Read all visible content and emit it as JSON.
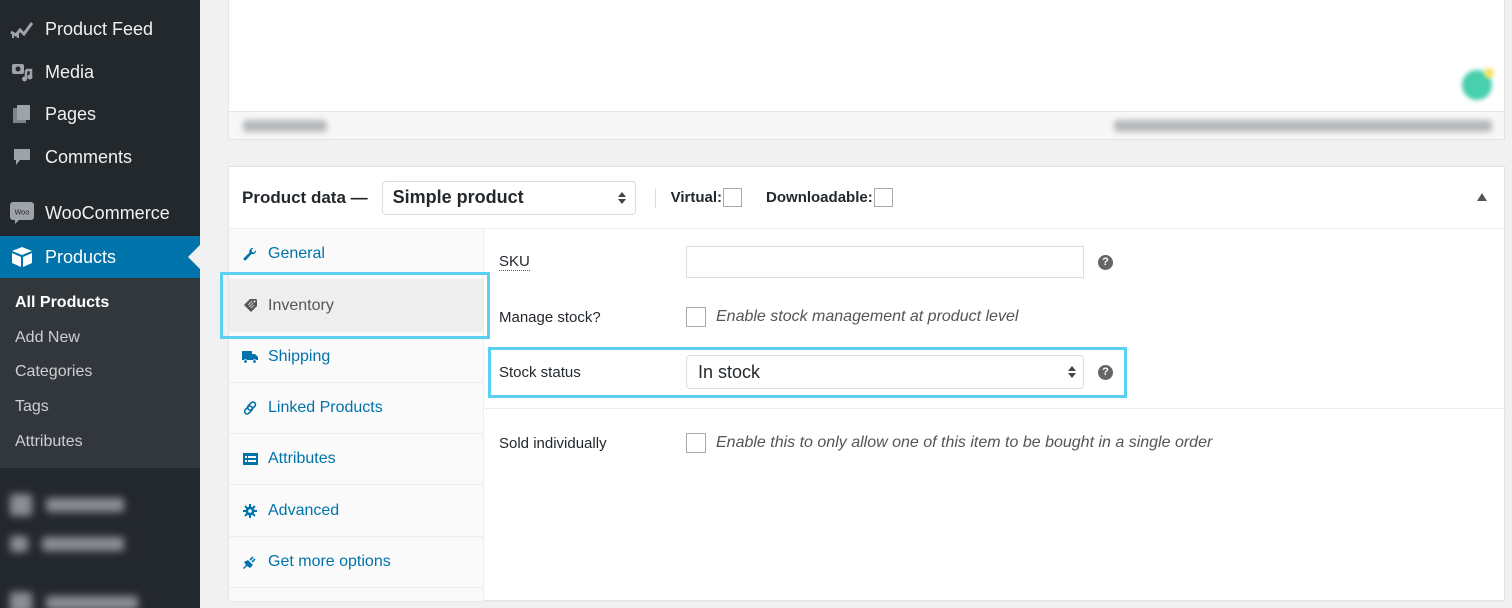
{
  "sidebar": {
    "items": [
      {
        "label": "Product Feed",
        "icon": "product-feed-icon"
      },
      {
        "label": "Media",
        "icon": "media-icon"
      },
      {
        "label": "Pages",
        "icon": "pages-icon"
      },
      {
        "label": "Comments",
        "icon": "comments-icon"
      },
      {
        "label": "WooCommerce",
        "icon": "woocommerce-icon"
      },
      {
        "label": "Products",
        "icon": "products-icon",
        "active": true
      }
    ],
    "submenu": [
      {
        "label": "All Products",
        "current": true
      },
      {
        "label": "Add New"
      },
      {
        "label": "Categories"
      },
      {
        "label": "Tags"
      },
      {
        "label": "Attributes"
      }
    ]
  },
  "product_data": {
    "title": "Product data —",
    "type_select": {
      "value": "Simple product"
    },
    "virtual_label": "Virtual:",
    "virtual_checked": false,
    "downloadable_label": "Downloadable:",
    "downloadable_checked": false,
    "tabs": [
      {
        "label": "General",
        "icon": "wrench-icon"
      },
      {
        "label": "Inventory",
        "icon": "tag-icon",
        "active": true
      },
      {
        "label": "Shipping",
        "icon": "truck-icon"
      },
      {
        "label": "Linked Products",
        "icon": "link-icon"
      },
      {
        "label": "Attributes",
        "icon": "list-icon"
      },
      {
        "label": "Advanced",
        "icon": "gear-icon"
      },
      {
        "label": "Get more options",
        "icon": "plug-icon"
      }
    ],
    "inventory": {
      "sku_label": "SKU",
      "sku_value": "",
      "manage_stock_label": "Manage stock?",
      "manage_stock_desc": "Enable stock management at product level",
      "manage_stock_checked": false,
      "stock_status_label": "Stock status",
      "stock_status_value": "In stock",
      "sold_individually_label": "Sold individually",
      "sold_individually_desc": "Enable this to only allow one of this item to be bought in a single order",
      "sold_individually_checked": false,
      "help_glyph": "?"
    }
  },
  "colors": {
    "sidebar_bg": "#23282d",
    "active_menu": "#0073aa",
    "highlight": "#5bd0f0",
    "link": "#0073aa"
  }
}
